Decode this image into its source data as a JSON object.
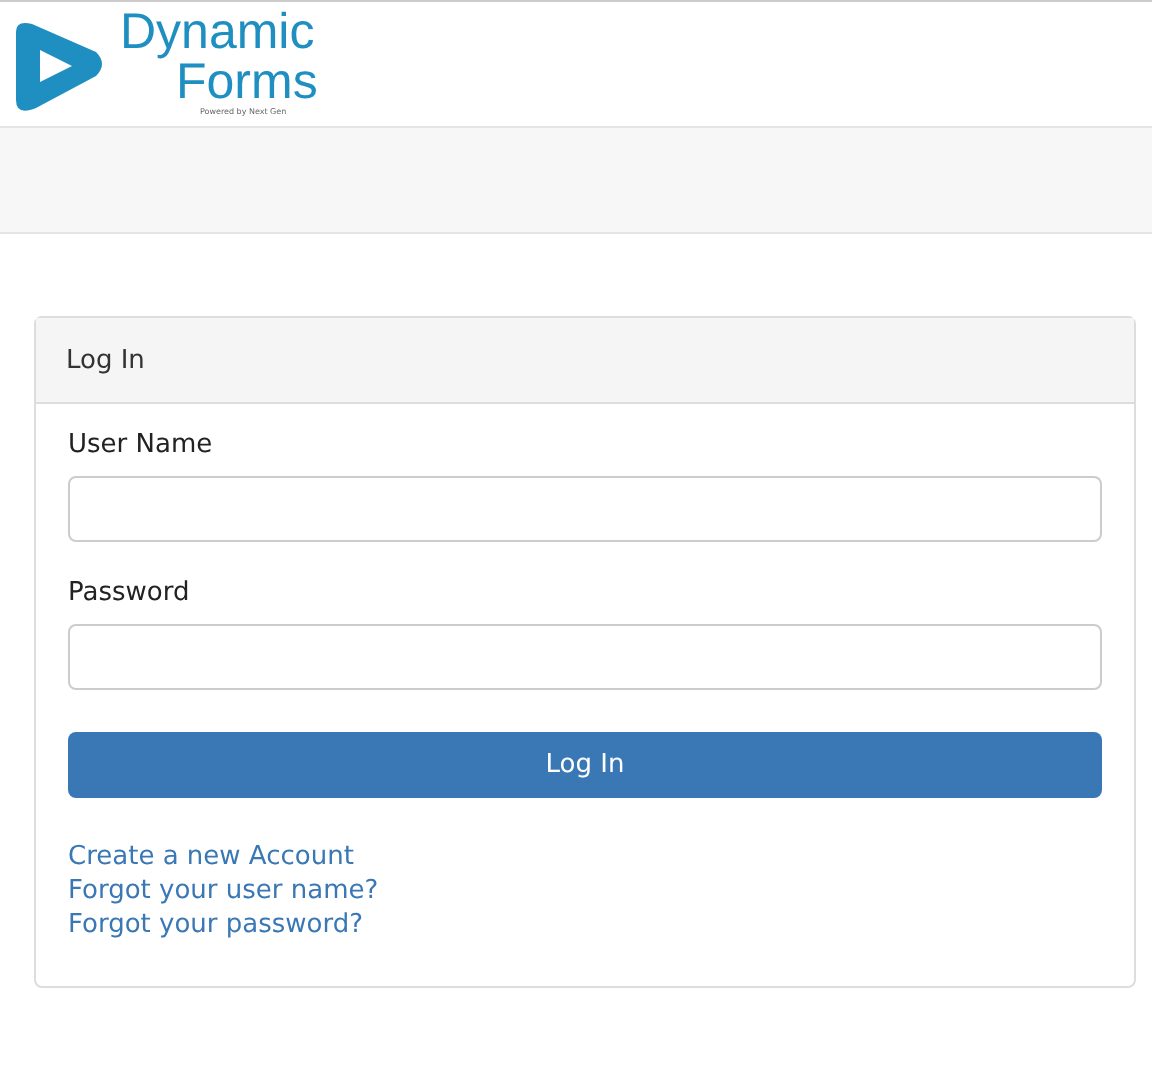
{
  "logo": {
    "line1": "Dynamic",
    "line2": "Forms",
    "tagline": "Powered by Next Gen"
  },
  "panel": {
    "title": "Log In"
  },
  "fields": [
    {
      "label": "User Name"
    },
    {
      "label": "Password"
    }
  ],
  "button": "Log In",
  "links": [
    "Create a new Account",
    "Forgot your user name?",
    "Forgot your password?"
  ]
}
